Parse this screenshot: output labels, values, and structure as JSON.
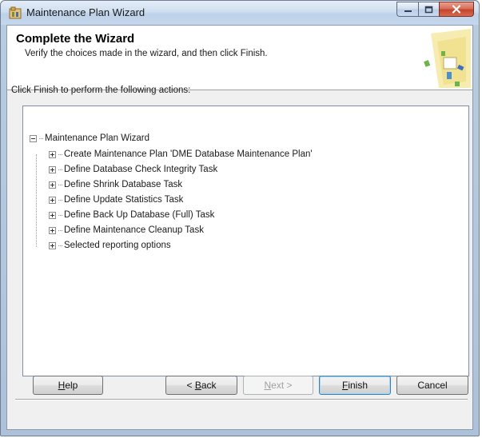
{
  "window": {
    "title": "Maintenance Plan Wizard",
    "accent": "#3c7fb1",
    "close_color": "#c3442b"
  },
  "header": {
    "title": "Complete the Wizard",
    "subtitle": "Verify the choices made in the wizard, and then click Finish.",
    "graphic_icon": "wizard-graphic-icon"
  },
  "prompt": "Click Finish to perform the following actions:",
  "tree": {
    "root": {
      "label": "Maintenance Plan Wizard",
      "expanded": true
    },
    "children": [
      {
        "label": "Create Maintenance Plan 'DME Database Maintenance Plan'"
      },
      {
        "label": "Define Database Check Integrity Task"
      },
      {
        "label": "Define Shrink Database Task"
      },
      {
        "label": "Define Update Statistics Task"
      },
      {
        "label": "Define Back Up Database (Full) Task"
      },
      {
        "label": "Define Maintenance Cleanup Task"
      },
      {
        "label": "Selected reporting options"
      }
    ]
  },
  "buttons": {
    "help": {
      "mnemonic": "H",
      "rest": "elp"
    },
    "back": {
      "pre": "< ",
      "mnemonic": "B",
      "rest": "ack"
    },
    "next": {
      "mnemonic": "N",
      "rest": "ext >"
    },
    "finish": {
      "mnemonic": "F",
      "rest": "inish"
    },
    "cancel": {
      "label": "Cancel"
    }
  }
}
